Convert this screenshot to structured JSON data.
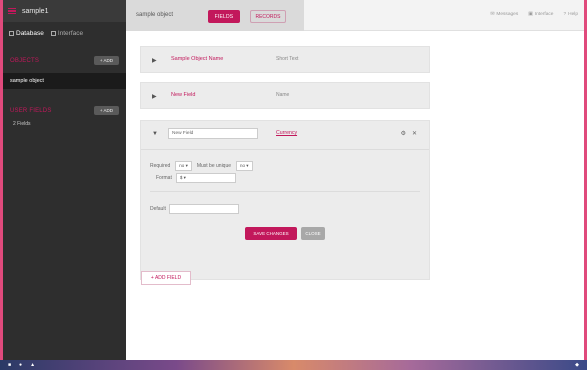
{
  "app": {
    "name": "sample1"
  },
  "sidebar": {
    "tabs": [
      {
        "label": "Database"
      },
      {
        "label": "Interface"
      }
    ],
    "objects_label": "OBJECTS",
    "objects_add": "+ ADD",
    "object_items": [
      "sample object"
    ],
    "user_fields_label": "USER FIELDS",
    "user_fields_add": "+ ADD",
    "user_field_items": [
      "2 Fields"
    ]
  },
  "topbar": {
    "object_title": "sample object",
    "tab_fields": "FIELDS",
    "tab_records": "RECORDS",
    "actions": [
      "Messages",
      "Interface",
      "Help"
    ]
  },
  "fields": [
    {
      "name": "Sample Object Name",
      "type": "Short Text"
    },
    {
      "name": "New Field",
      "type": "Name"
    }
  ],
  "edit_field": {
    "name_value": "New Field",
    "type_label": "Currency",
    "required_label": "Required",
    "required_value": "no",
    "must_be_unique_label": "Must be unique",
    "must_be_unique_value": "no",
    "format_label": "Format",
    "format_value": "$",
    "default_label": "Default",
    "default_value": "",
    "save_label": "SAVE CHANGES",
    "cancel_label": "CLOSE"
  },
  "add_field_label": "+ ADD FIELD",
  "colors": {
    "accent": "#c2185b",
    "sidebar": "#2e2e2e"
  }
}
